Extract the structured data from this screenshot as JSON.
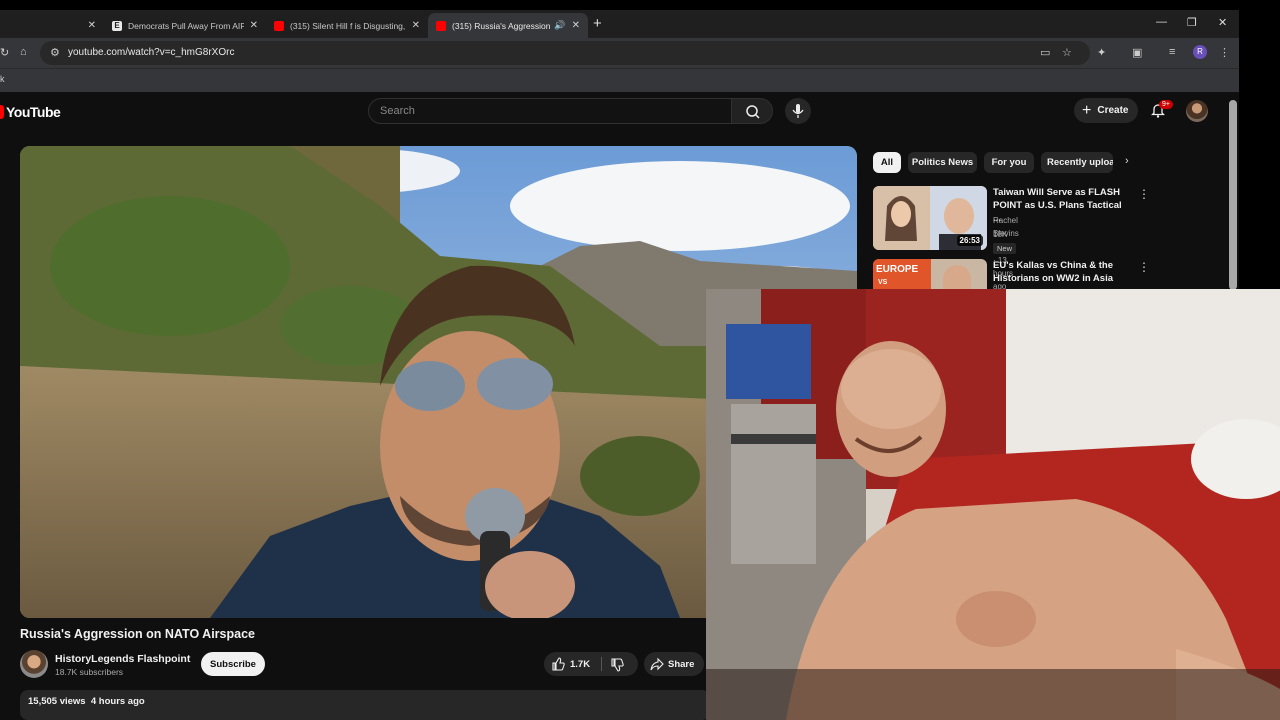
{
  "browser": {
    "tabs": [
      {
        "title": ""
      },
      {
        "title": "Democrats Pull Away From AIPAC"
      },
      {
        "title": "(315) Silent Hill f is Disgusting,"
      },
      {
        "title": "(315) Russia's Aggression on"
      }
    ],
    "address": "youtube.com/watch?v=c_hmG8rXOrc",
    "bookmark_fragment": "k",
    "profile_initial": "R"
  },
  "youtube": {
    "logo": "YouTube",
    "search_placeholder": "Search",
    "create_label": "Create",
    "notifications_badge": "9+",
    "video": {
      "title": "Russia's Aggression on NATO Airspace",
      "channel": "HistoryLegends Flashpoint",
      "subscribers": "18.7K subscribers",
      "subscribe_label": "Subscribe",
      "likes": "1.7K",
      "share_label": "Share",
      "views": "15,505 views",
      "age": "4 hours ago"
    },
    "chips": [
      "All",
      "Politics News",
      "For you",
      "Recently uploaded"
    ],
    "recommendations": [
      {
        "title": "Taiwan Will Serve as FLASH POINT as U.S. Plans Tactical ...",
        "channel": "Rachel Blevins",
        "meta": "18K views · 13 hours ago",
        "tag": "New",
        "duration": "26:53"
      },
      {
        "title": "EU's Kallas vs China & the Historians on WW2 in Asia",
        "thumb_text": "EUROPE",
        "thumb_sub": "VS"
      }
    ]
  },
  "colors": {
    "yt_background": "#0f0f0f",
    "brand_red": "#ff0000",
    "chip_active": "#f1f1f1",
    "chrome_tabstrip": "#1f1f1f",
    "chrome_toolbar": "#35363a"
  }
}
